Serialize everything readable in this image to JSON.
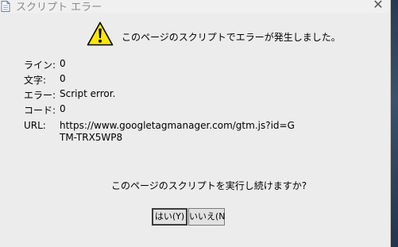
{
  "window": {
    "title": "スクリプト エラー",
    "close_glyph": "✕"
  },
  "message": {
    "headline": "このページのスクリプトでエラーが発生しました。"
  },
  "details": {
    "line_label": "ライン:",
    "line_value": "0",
    "char_label": "文字:",
    "char_value": "0",
    "error_label": "エラー:",
    "error_value": "Script error.",
    "code_label": "コード:",
    "code_value": "0",
    "url_label": "URL:",
    "url_value": "https://www.googletagmanager.com/gtm.js?id=GTM-TRX5WP8"
  },
  "prompt": {
    "question": "このページのスクリプトを実行し続けますか?"
  },
  "buttons": {
    "yes_label": "はい(Y)",
    "no_label": "いいえ(N"
  },
  "icons": {
    "app": "document-icon",
    "warning": "warning-icon",
    "warning_color": "#ffe600"
  }
}
